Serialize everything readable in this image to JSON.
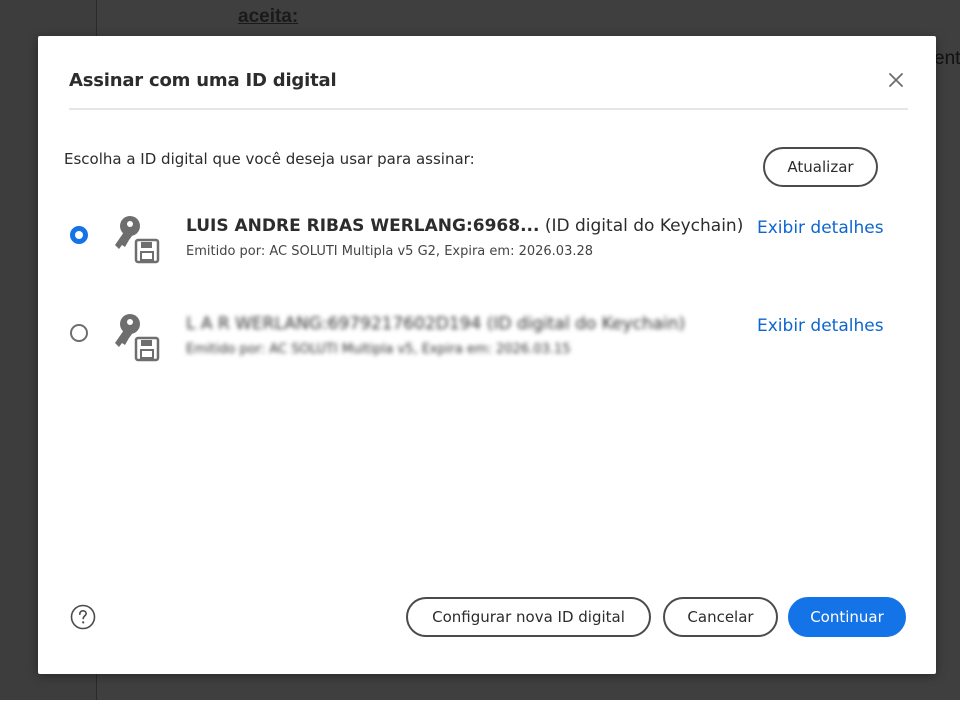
{
  "background": {
    "heading": "aceita:",
    "edge_text": "ent"
  },
  "dialog": {
    "title": "Assinar com uma ID digital",
    "prompt": "Escolha a ID digital que você deseja usar para assinar:",
    "update_label": "Atualizar",
    "ids": [
      {
        "name": "LUIS ANDRE RIBAS WERLANG:6968...",
        "source": "(ID digital do Keychain)",
        "detail": "Emitido por: AC SOLUTI Multipla v5 G2, Expira em: 2026.03.28",
        "link": "Exibir detalhes",
        "selected": true
      },
      {
        "name": "L A R WERLANG:6979217602D194 (ID digital do Keychain)",
        "detail": "Emitido por: AC SOLUTI Multipla v5, Expira em: 2026.03.15",
        "link": "Exibir detalhes",
        "selected": false
      }
    ],
    "buttons": {
      "configure": "Configurar nova ID digital",
      "cancel": "Cancelar",
      "continue": "Continuar"
    },
    "icons": {
      "close": "close-icon",
      "key": "key-icon",
      "help": "help-icon"
    },
    "colors": {
      "accent": "#1473e6",
      "link": "#0d66d0"
    }
  }
}
